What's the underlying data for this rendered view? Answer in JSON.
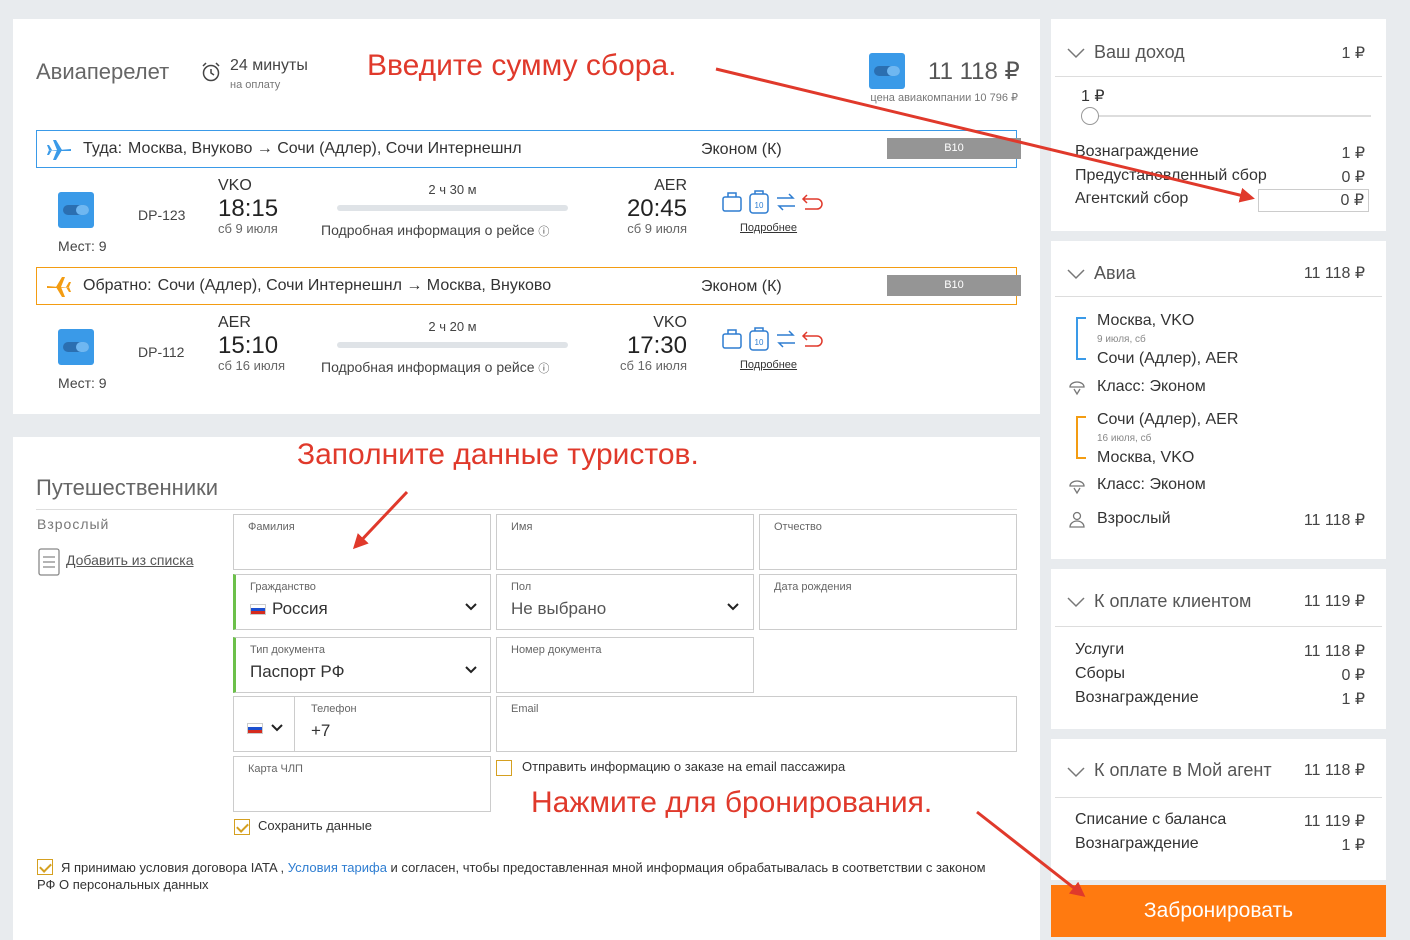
{
  "flight": {
    "title": "Авиаперелет",
    "timer_value": "24 минуты",
    "timer_caption": "на оплату",
    "price": "11 118 ₽",
    "airline_price": "цена авиакомпании 10 796 ₽",
    "details_link": "Подробная информация о рейсе",
    "more_link": "Подробнее",
    "outbound": {
      "label": "Туда:",
      "route": "Москва, Внуково → Сочи (Адлер), Сочи Интернешнл",
      "class": "Эконом (К)",
      "tag": "B10",
      "flight_no": "DP-123",
      "seats": "Мест: 9",
      "dep_code": "VKO",
      "dep_time": "18:15",
      "dep_date": "сб 9 июля",
      "duration": "2 ч 30 м",
      "arr_code": "AER",
      "arr_time": "20:45",
      "arr_date": "сб 9 июля",
      "color": "#3a9ae8"
    },
    "inbound": {
      "label": "Обратно:",
      "route": "Сочи (Адлер), Сочи Интернешнл → Москва, Внуково",
      "class": "Эконом (К)",
      "tag": "B10",
      "flight_no": "DP-112",
      "seats": "Мест: 9",
      "dep_code": "AER",
      "dep_time": "15:10",
      "dep_date": "сб 16 июля",
      "duration": "2 ч 20 м",
      "arr_code": "VKO",
      "arr_time": "17:30",
      "arr_date": "сб 16 июля",
      "color": "#f39c12"
    }
  },
  "travelers": {
    "title": "Путешественники",
    "type": "Взрослый",
    "add_from_list": "Добавить из списка",
    "fields": {
      "lastname": "Фамилия",
      "firstname": "Имя",
      "middlename": "Отчество",
      "citizenship": "Гражданство",
      "citizenship_value": "Россия",
      "gender": "Пол",
      "gender_value": "Не выбрано",
      "birthdate": "Дата рождения",
      "doc_type": "Тип документа",
      "doc_type_value": "Паспорт РФ",
      "doc_number": "Номер документа",
      "phone": "Телефон",
      "phone_value": "+7",
      "email": "Email",
      "card": "Карта ЧЛП"
    },
    "send_info": "Отправить информацию о заказе на email пассажира",
    "save_data": "Сохранить данные",
    "terms_part1": "Я принимаю условия договора IATA ,",
    "terms_link": "Условия тарифа",
    "terms_part2": "и согласен, чтобы предоставленная мной информация обрабатывалась в соответствии с законом",
    "terms_part3": "РФ О персональных данных"
  },
  "income": {
    "title": "Ваш доход",
    "total": "1 ₽",
    "slider_value": "1 ₽",
    "slider_fraction": 0,
    "rows": [
      {
        "label": "Вознаграждение",
        "value": "1 ₽"
      },
      {
        "label": "Предустановленный сбор",
        "value": "0 ₽"
      },
      {
        "label": "Агентский сбор",
        "value": "0 ₽"
      }
    ]
  },
  "avia": {
    "title": "Авиа",
    "total": "11 118 ₽",
    "seg1_from": "Москва, VKO",
    "seg1_date": "9 июля, сб",
    "seg1_to": "Сочи (Адлер), AER",
    "seg1_class": "Класс: Эконом",
    "seg2_from": "Сочи (Адлер), AER",
    "seg2_date": "16 июля, сб",
    "seg2_to": "Москва, VKO",
    "seg2_class": "Класс: Эконом",
    "passenger": "Взрослый",
    "passenger_price": "11 118 ₽"
  },
  "client_pay": {
    "title": "К оплате клиентом",
    "total": "11 119 ₽",
    "rows": [
      {
        "label": "Услуги",
        "value": "11 118 ₽"
      },
      {
        "label": "Сборы",
        "value": "0 ₽"
      },
      {
        "label": "Вознаграждение",
        "value": "1 ₽"
      }
    ]
  },
  "agent_pay": {
    "title": "К оплате в Мой агент",
    "total": "11 118 ₽",
    "rows": [
      {
        "label": "Списание с баланса",
        "value": "11 119 ₽"
      },
      {
        "label": "Вознаграждение",
        "value": "1 ₽"
      }
    ]
  },
  "book_button": "Забронировать",
  "annotations": {
    "fee": "Введите сумму сбора.",
    "tourists": "Заполните данные туристов.",
    "book": "Нажмите для бронирования."
  },
  "colors": {
    "accent": "#ff7a10",
    "annotation": "#e0392b",
    "outbound": "#3a9ae8",
    "inbound": "#f39c12"
  }
}
